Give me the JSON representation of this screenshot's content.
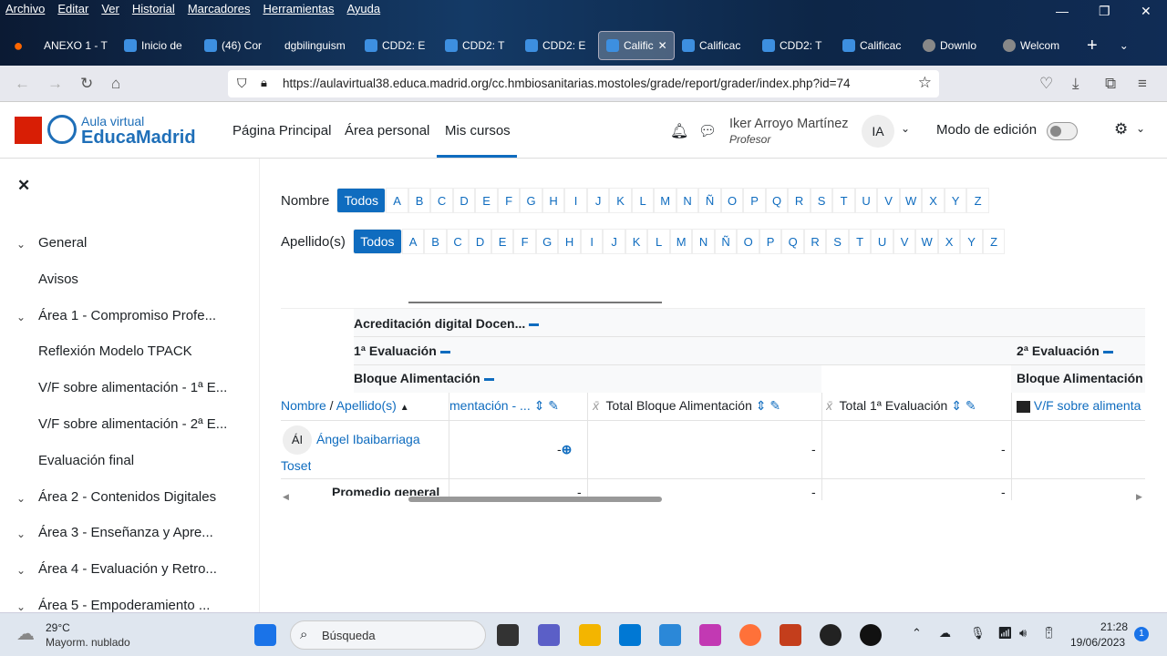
{
  "menubar": [
    "Archivo",
    "Editar",
    "Ver",
    "Historial",
    "Marcadores",
    "Herramientas",
    "Ayuda"
  ],
  "tabs": [
    "ANEXO 1 - T",
    "Inicio de",
    "(46) Cor",
    "dgbilinguism",
    "CDD2: E",
    "CDD2: T",
    "CDD2: E",
    "Calific",
    "Calificac",
    "CDD2: T",
    "Calificac",
    "Downlo",
    "Welcom"
  ],
  "url": "https://aulavirtual38.educa.madrid.org/cc.hmbiosanitarias.mostoles/grade/report/grader/index.php?id=74",
  "header": {
    "logo_top": "Aula virtual",
    "logo_bottom": "EducaMadrid",
    "nav": [
      "Página Principal",
      "Área personal",
      "Mis cursos"
    ],
    "user_name": "Iker Arroyo Martínez",
    "user_role": "Profesor",
    "avatar": "IA",
    "edit_mode": "Modo de edición",
    "edit_mode_on": false
  },
  "sidebar": [
    {
      "label": "General",
      "chevron": true
    },
    {
      "label": "Avisos"
    },
    {
      "label": "Área 1 - Compromiso Profe...",
      "chevron": true
    },
    {
      "label": "Reflexión Modelo TPACK"
    },
    {
      "label": "V/F sobre alimentación - 1ª E..."
    },
    {
      "label": "V/F sobre alimentación - 2ª E..."
    },
    {
      "label": "Evaluación final"
    },
    {
      "label": "Área 2 - Contenidos Digitales",
      "chevron": true
    },
    {
      "label": "Área 3 - Enseñanza y Apre...",
      "chevron": true
    },
    {
      "label": "Área 4 - Evaluación y Retro...",
      "chevron": true
    },
    {
      "label": "Área 5 - Empoderamiento ...",
      "chevron": true
    }
  ],
  "filter": {
    "nombre_label": "Nombre",
    "apellido_label": "Apellido(s)",
    "all": "Todos",
    "letters": [
      "A",
      "B",
      "C",
      "D",
      "E",
      "F",
      "G",
      "H",
      "I",
      "J",
      "K",
      "L",
      "M",
      "N",
      "Ñ",
      "O",
      "P",
      "Q",
      "R",
      "S",
      "T",
      "U",
      "V",
      "W",
      "X",
      "Y",
      "Z"
    ]
  },
  "grader": {
    "category": "Acreditación digital Docen...",
    "eval1": "1ª Evaluación",
    "eval2": "2ª Evaluación",
    "block1": "Bloque Alimentación",
    "block2": "Bloque Alimentación",
    "col_name": "Nombre",
    "col_sep": " / ",
    "col_surname": "Apellido(s)",
    "col1": "mentación - ...",
    "col2": "Total Bloque Alimentación",
    "col3": "Total 1ª Evaluación",
    "col4": "V/F sobre alimenta",
    "student_initials": "ÁI",
    "student_first": "Ángel Ibaibarriaga",
    "student_last": "Toset",
    "student_vals": [
      "-",
      "-",
      "-"
    ],
    "avg_label": "Promedio general",
    "avg_vals": [
      "-",
      "-",
      "-"
    ]
  },
  "taskbar": {
    "temp": "29°C",
    "weather": "Mayorm. nublado",
    "search": "Búsqueda",
    "time": "21:28",
    "date": "19/06/2023",
    "badge": "1"
  }
}
